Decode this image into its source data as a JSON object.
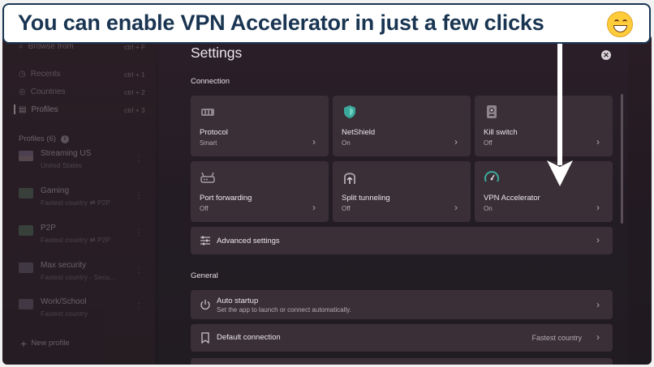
{
  "banner": {
    "text": "You can enable VPN Accelerator in just a few clicks",
    "emoji": "grinning-face-emoji"
  },
  "sidebar": {
    "search": {
      "label": "Browse from",
      "shortcut": "ctrl + F"
    },
    "nav": [
      {
        "label": "Recents",
        "shortcut": "ctrl + 1"
      },
      {
        "label": "Countries",
        "shortcut": "ctrl + 2"
      },
      {
        "label": "Profiles",
        "shortcut": "ctrl + 3",
        "active": true
      }
    ],
    "profiles_heading": "Profiles (6)",
    "profiles": [
      {
        "name": "Streaming US",
        "sub": "United States"
      },
      {
        "name": "Gaming",
        "sub": "Fastest country",
        "extra": "P2P"
      },
      {
        "name": "P2P",
        "sub": "Fastest country",
        "extra": "P2P"
      },
      {
        "name": "Max security",
        "sub": "Fastest country - Secu..."
      },
      {
        "name": "Work/School",
        "sub": "Fastest country"
      }
    ],
    "new_profile": "New profile"
  },
  "settings": {
    "title": "Settings",
    "connection_label": "Connection",
    "tiles": [
      {
        "name": "Protocol",
        "value": "Smart",
        "icon": "protocol-icon"
      },
      {
        "name": "NetShield",
        "value": "On",
        "icon": "shield-icon"
      },
      {
        "name": "Kill switch",
        "value": "Off",
        "icon": "kill-switch-icon"
      },
      {
        "name": "Port forwarding",
        "value": "Off",
        "icon": "router-icon"
      },
      {
        "name": "Split tunneling",
        "value": "Off",
        "icon": "split-tunneling-icon"
      },
      {
        "name": "VPN Accelerator",
        "value": "On",
        "icon": "speedometer-icon"
      }
    ],
    "advanced": {
      "label": "Advanced settings"
    },
    "general_label": "General",
    "auto_startup": {
      "label": "Auto startup",
      "sub": "Set the app to launch or connect automatically."
    },
    "default_connection": {
      "label": "Default connection",
      "value": "Fastest country"
    }
  },
  "colors": {
    "banner_border": "#1a3552",
    "banner_text": "#1a3552",
    "tile_bg": "#3a2f37",
    "accent_teal": "#3aa89a"
  }
}
